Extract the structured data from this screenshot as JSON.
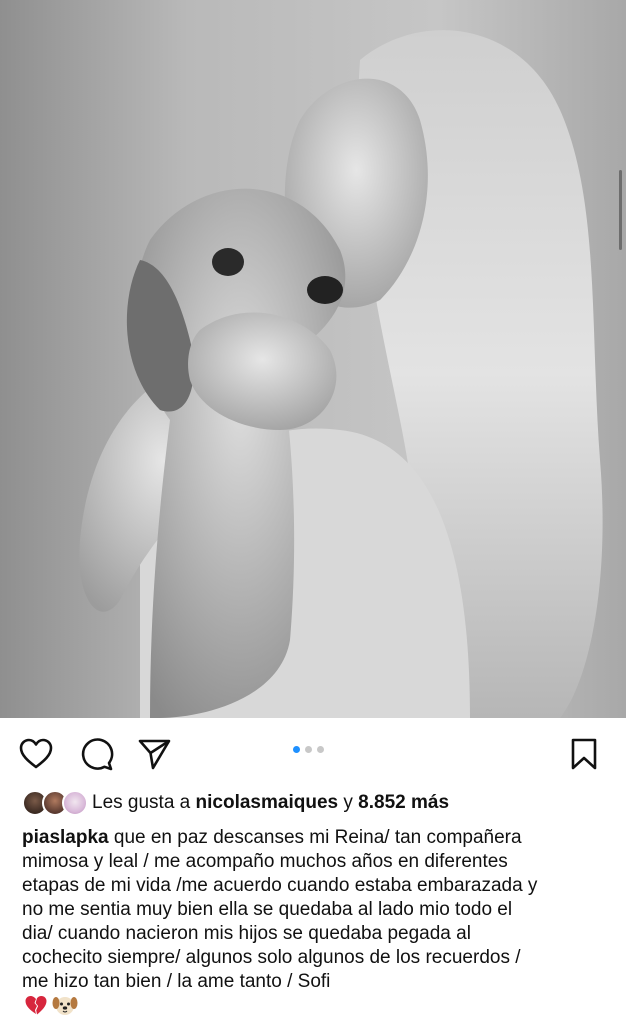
{
  "post": {
    "image": {
      "description_icon": "photo",
      "colors": {
        "tone": "#b8b8b8"
      }
    },
    "actions": {
      "like_icon": "heart-outline",
      "comment_icon": "comment-bubble",
      "share_icon": "paper-plane",
      "save_icon": "bookmark"
    },
    "carousel": {
      "total": 3,
      "active_index": 0,
      "active_color": "#1e90ff"
    },
    "likes": {
      "prefix": "Les gusta a ",
      "user": "nicolasmaiques",
      "connector": " y ",
      "count": "8.852 más"
    },
    "caption": {
      "username": "piaslapka",
      "lines": [
        " que en paz descanses mi Reina/ tan compañera",
        "mimosa y leal / me acompaño muchos años en diferentes",
        "etapas de mi vida /me acuerdo cuando estaba embarazada y",
        "no me sentia muy bien ella se quedaba al lado mio todo el",
        "dia/ cuando nacieron mis hijos se quedaba pegada al",
        "cochecito siempre/ algunos solo  algunos  de los recuerdos /",
        "me hizo tan bien / la ame tanto / Sofi"
      ],
      "emojis": [
        "broken-heart",
        "dog-face"
      ]
    }
  }
}
